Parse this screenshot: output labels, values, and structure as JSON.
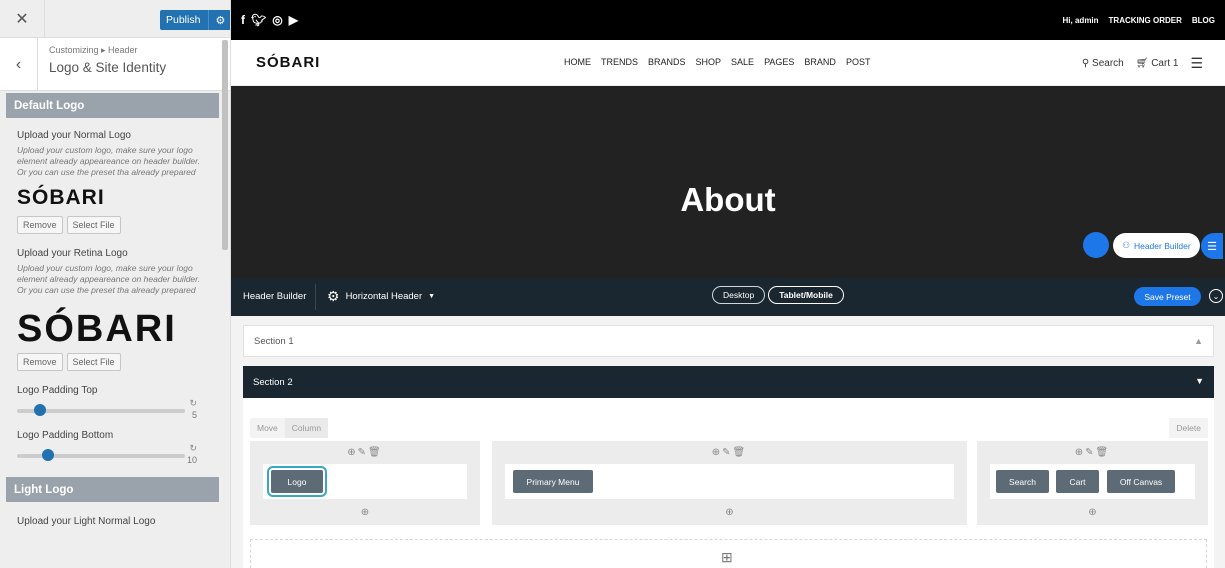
{
  "sidebar": {
    "close_icon": "close-icon",
    "publish_label": "Publish",
    "breadcrumb": "Customizing ▸ Header",
    "title": "Logo & Site Identity",
    "default_logo": {
      "heading": "Default Logo",
      "normal_label": "Upload your Normal Logo",
      "normal_desc": "Upload your custom logo, make sure your logo element already appeareance on header builder. Or you can use the preset tha already prepared",
      "normal_logo_text": "SÓBARI",
      "retina_label": "Upload your Retina Logo",
      "retina_desc": "Upload your custom logo, make sure your logo element already appeareance on header builder. Or you can use the preset tha already prepared",
      "retina_logo_text": "SÓBARI",
      "remove_label": "Remove",
      "select_label": "Select File"
    },
    "padding_top": {
      "label": "Logo Padding Top",
      "value": "5",
      "fraction": 0.1
    },
    "padding_bottom": {
      "label": "Logo Padding Bottom",
      "value": "10",
      "fraction": 0.15
    },
    "light_logo": {
      "heading": "Light Logo",
      "normal_label": "Upload your Light Normal Logo"
    }
  },
  "site": {
    "topbar": {
      "greeting": "Hi, admin",
      "tracking": "TRACKING ORDER",
      "blog": "BLOG"
    },
    "brand": "SÓBARI",
    "menu": [
      "HOME",
      "TRENDS",
      "BRANDS",
      "SHOP",
      "SALE",
      "PAGES",
      "BRAND",
      "POST"
    ],
    "search_label": "Search",
    "cart_label": "Cart 1",
    "hero_title": "About",
    "header_builder_pill": "Header Builder"
  },
  "builder": {
    "bar_label": "Header Builder",
    "type_label": "Horizontal Header",
    "desktop_label": "Desktop",
    "mobile_label": "Tablet/Mobile",
    "save_preset_label": "Save Preset",
    "section1": "Section 1",
    "section2": "Section 2",
    "move_label": "Move",
    "column_label": "Column",
    "delete_label": "Delete",
    "col1_items": [
      "Logo"
    ],
    "col2_items": [
      "Primary Menu"
    ],
    "col3_items": [
      "Search",
      "Cart",
      "Off Canvas"
    ]
  },
  "colors": {
    "accent_blue": "#1e77e8",
    "publish_blue": "#2271b1",
    "dark_bar": "#1b2730",
    "hero_bg": "#222222",
    "element_bg": "#5c6b76",
    "logo_highlight": "#39a7c4"
  }
}
